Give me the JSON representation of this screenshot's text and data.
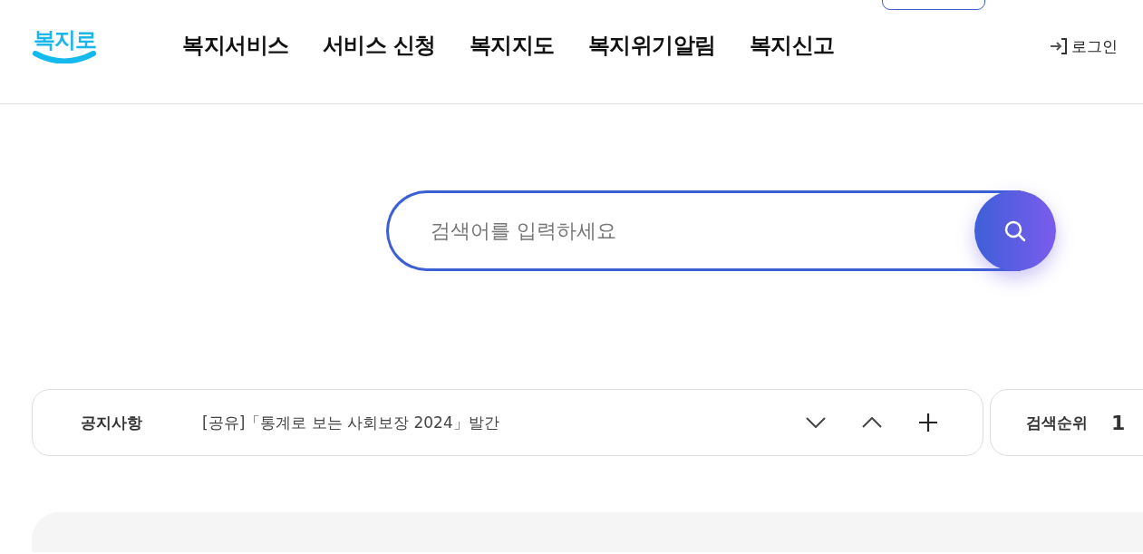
{
  "logo": {
    "text": "복지로"
  },
  "nav": [
    {
      "label": "복지서비스"
    },
    {
      "label": "서비스 신청"
    },
    {
      "label": "복지지도"
    },
    {
      "label": "복지위기알림"
    },
    {
      "label": "복지신고"
    }
  ],
  "login": {
    "label": "로그인"
  },
  "search": {
    "placeholder": "검색어를 입력하세요"
  },
  "notice": {
    "heading": "공지사항",
    "text": "[공유]「통계로 보는 사회보장 2024」발간"
  },
  "ranking": {
    "heading": "검색순위",
    "rank": "1"
  }
}
